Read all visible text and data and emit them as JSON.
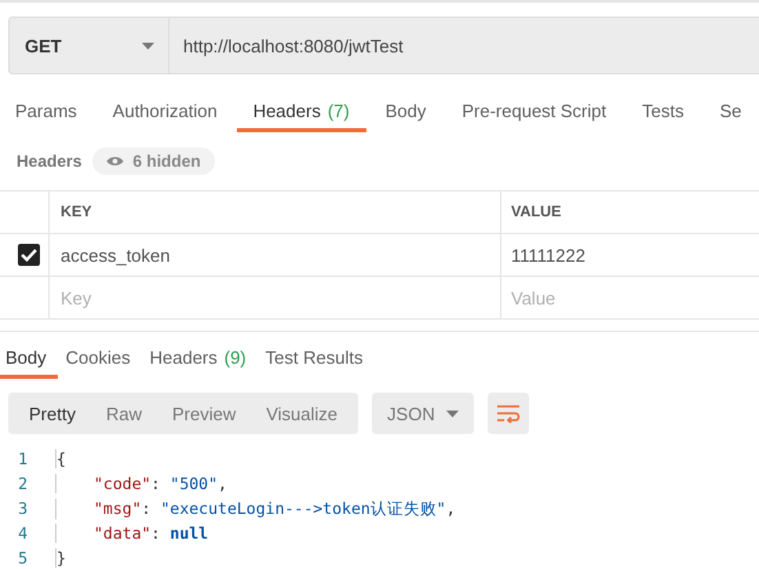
{
  "request": {
    "method": "GET",
    "url": "http://localhost:8080/jwtTest"
  },
  "request_tabs": [
    {
      "label": "Params",
      "selected": false
    },
    {
      "label": "Authorization",
      "selected": false
    },
    {
      "label": "Headers",
      "count": "(7)",
      "selected": true
    },
    {
      "label": "Body",
      "selected": false
    },
    {
      "label": "Pre-request Script",
      "selected": false
    },
    {
      "label": "Tests",
      "selected": false
    },
    {
      "label": "Se",
      "selected": false
    }
  ],
  "headers_bar": {
    "title": "Headers",
    "hidden_toggle": "6 hidden"
  },
  "headers_table": {
    "columns": [
      "KEY",
      "VALUE"
    ],
    "rows": [
      {
        "checked": true,
        "key": "access_token",
        "value": "11111222"
      }
    ],
    "new_row": {
      "key_placeholder": "Key",
      "value_placeholder": "Value"
    }
  },
  "response_tabs": [
    {
      "label": "Body",
      "selected": true
    },
    {
      "label": "Cookies",
      "selected": false
    },
    {
      "label": "Headers",
      "count": "(9)",
      "selected": false
    },
    {
      "label": "Test Results",
      "selected": false
    }
  ],
  "view_modes": [
    {
      "label": "Pretty",
      "selected": true
    },
    {
      "label": "Raw",
      "selected": false
    },
    {
      "label": "Preview",
      "selected": false
    },
    {
      "label": "Visualize",
      "selected": false
    }
  ],
  "format": "JSON",
  "code": [
    {
      "number": "1",
      "kind": "brace",
      "tokens": [
        {
          "kind": "punct",
          "text": "{"
        }
      ]
    },
    {
      "number": "2",
      "kind": "entry",
      "tokens": [
        {
          "kind": "key",
          "text": "\"code\""
        },
        {
          "kind": "punct",
          "text": ": "
        },
        {
          "kind": "string",
          "text": "\"500\""
        },
        {
          "kind": "punct",
          "text": ","
        }
      ]
    },
    {
      "number": "3",
      "kind": "entry",
      "tokens": [
        {
          "kind": "key",
          "text": "\"msg\""
        },
        {
          "kind": "punct",
          "text": ": "
        },
        {
          "kind": "string",
          "text": "\"executeLogin--->token认证失败\""
        },
        {
          "kind": "punct",
          "text": ","
        }
      ]
    },
    {
      "number": "4",
      "kind": "entry",
      "tokens": [
        {
          "kind": "key",
          "text": "\"data\""
        },
        {
          "kind": "punct",
          "text": ": "
        },
        {
          "kind": "keyword",
          "text": "null"
        }
      ]
    },
    {
      "number": "5",
      "kind": "brace",
      "tokens": [
        {
          "kind": "punct",
          "text": "}"
        }
      ]
    }
  ]
}
